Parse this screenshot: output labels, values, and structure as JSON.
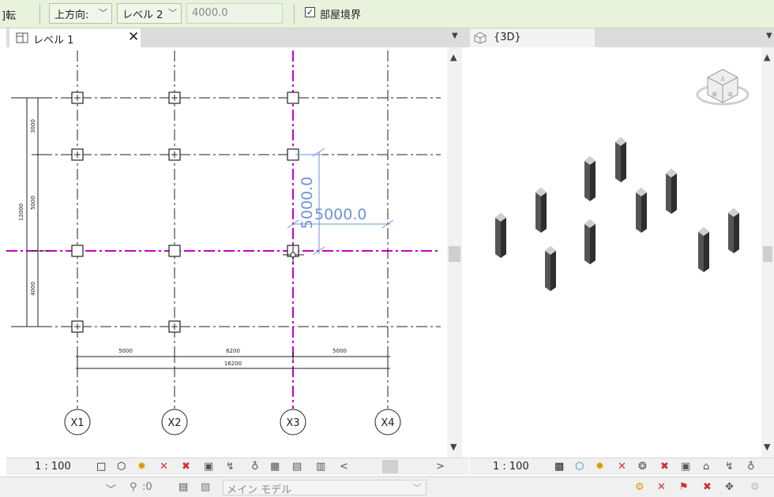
{
  "options_bar": {
    "rotate_label": "]転",
    "orientation_value": "上方向:",
    "level_value": "レベル 2",
    "offset_value": "4000.0",
    "room_bounding_checked": "✓",
    "room_bounding_label": "部屋境界"
  },
  "left_view": {
    "tab_title": "レベル 1",
    "close_glyph": "✕",
    "scale": "1 : 100",
    "grid_bubbles": [
      "X1",
      "X2",
      "X3",
      "X4"
    ],
    "vertical_dims": [
      "3000",
      "5000",
      "4000"
    ],
    "vertical_total": "12000",
    "horizontal_dims": [
      "5000",
      "6200",
      "5000"
    ],
    "horizontal_total": "16200",
    "temp_dim_horizontal": "5000.0",
    "temp_dim_vertical": "5000.0",
    "accent_color": "#c400c4",
    "dim_color": "#6c94d6",
    "nav_left": "<",
    "nav_right": ">"
  },
  "right_view": {
    "tab_title": "{3D}",
    "scale": "1 : 100",
    "viewcube_faces": [
      "上",
      "前",
      "右"
    ]
  },
  "status_bar": {
    "workset": ":0",
    "model": "メイン モデル"
  },
  "icons": [
    "plan-view-icon",
    "3d-view-icon",
    "viewcube-icon",
    "checkbox-icon",
    "chevron-down-icon"
  ]
}
